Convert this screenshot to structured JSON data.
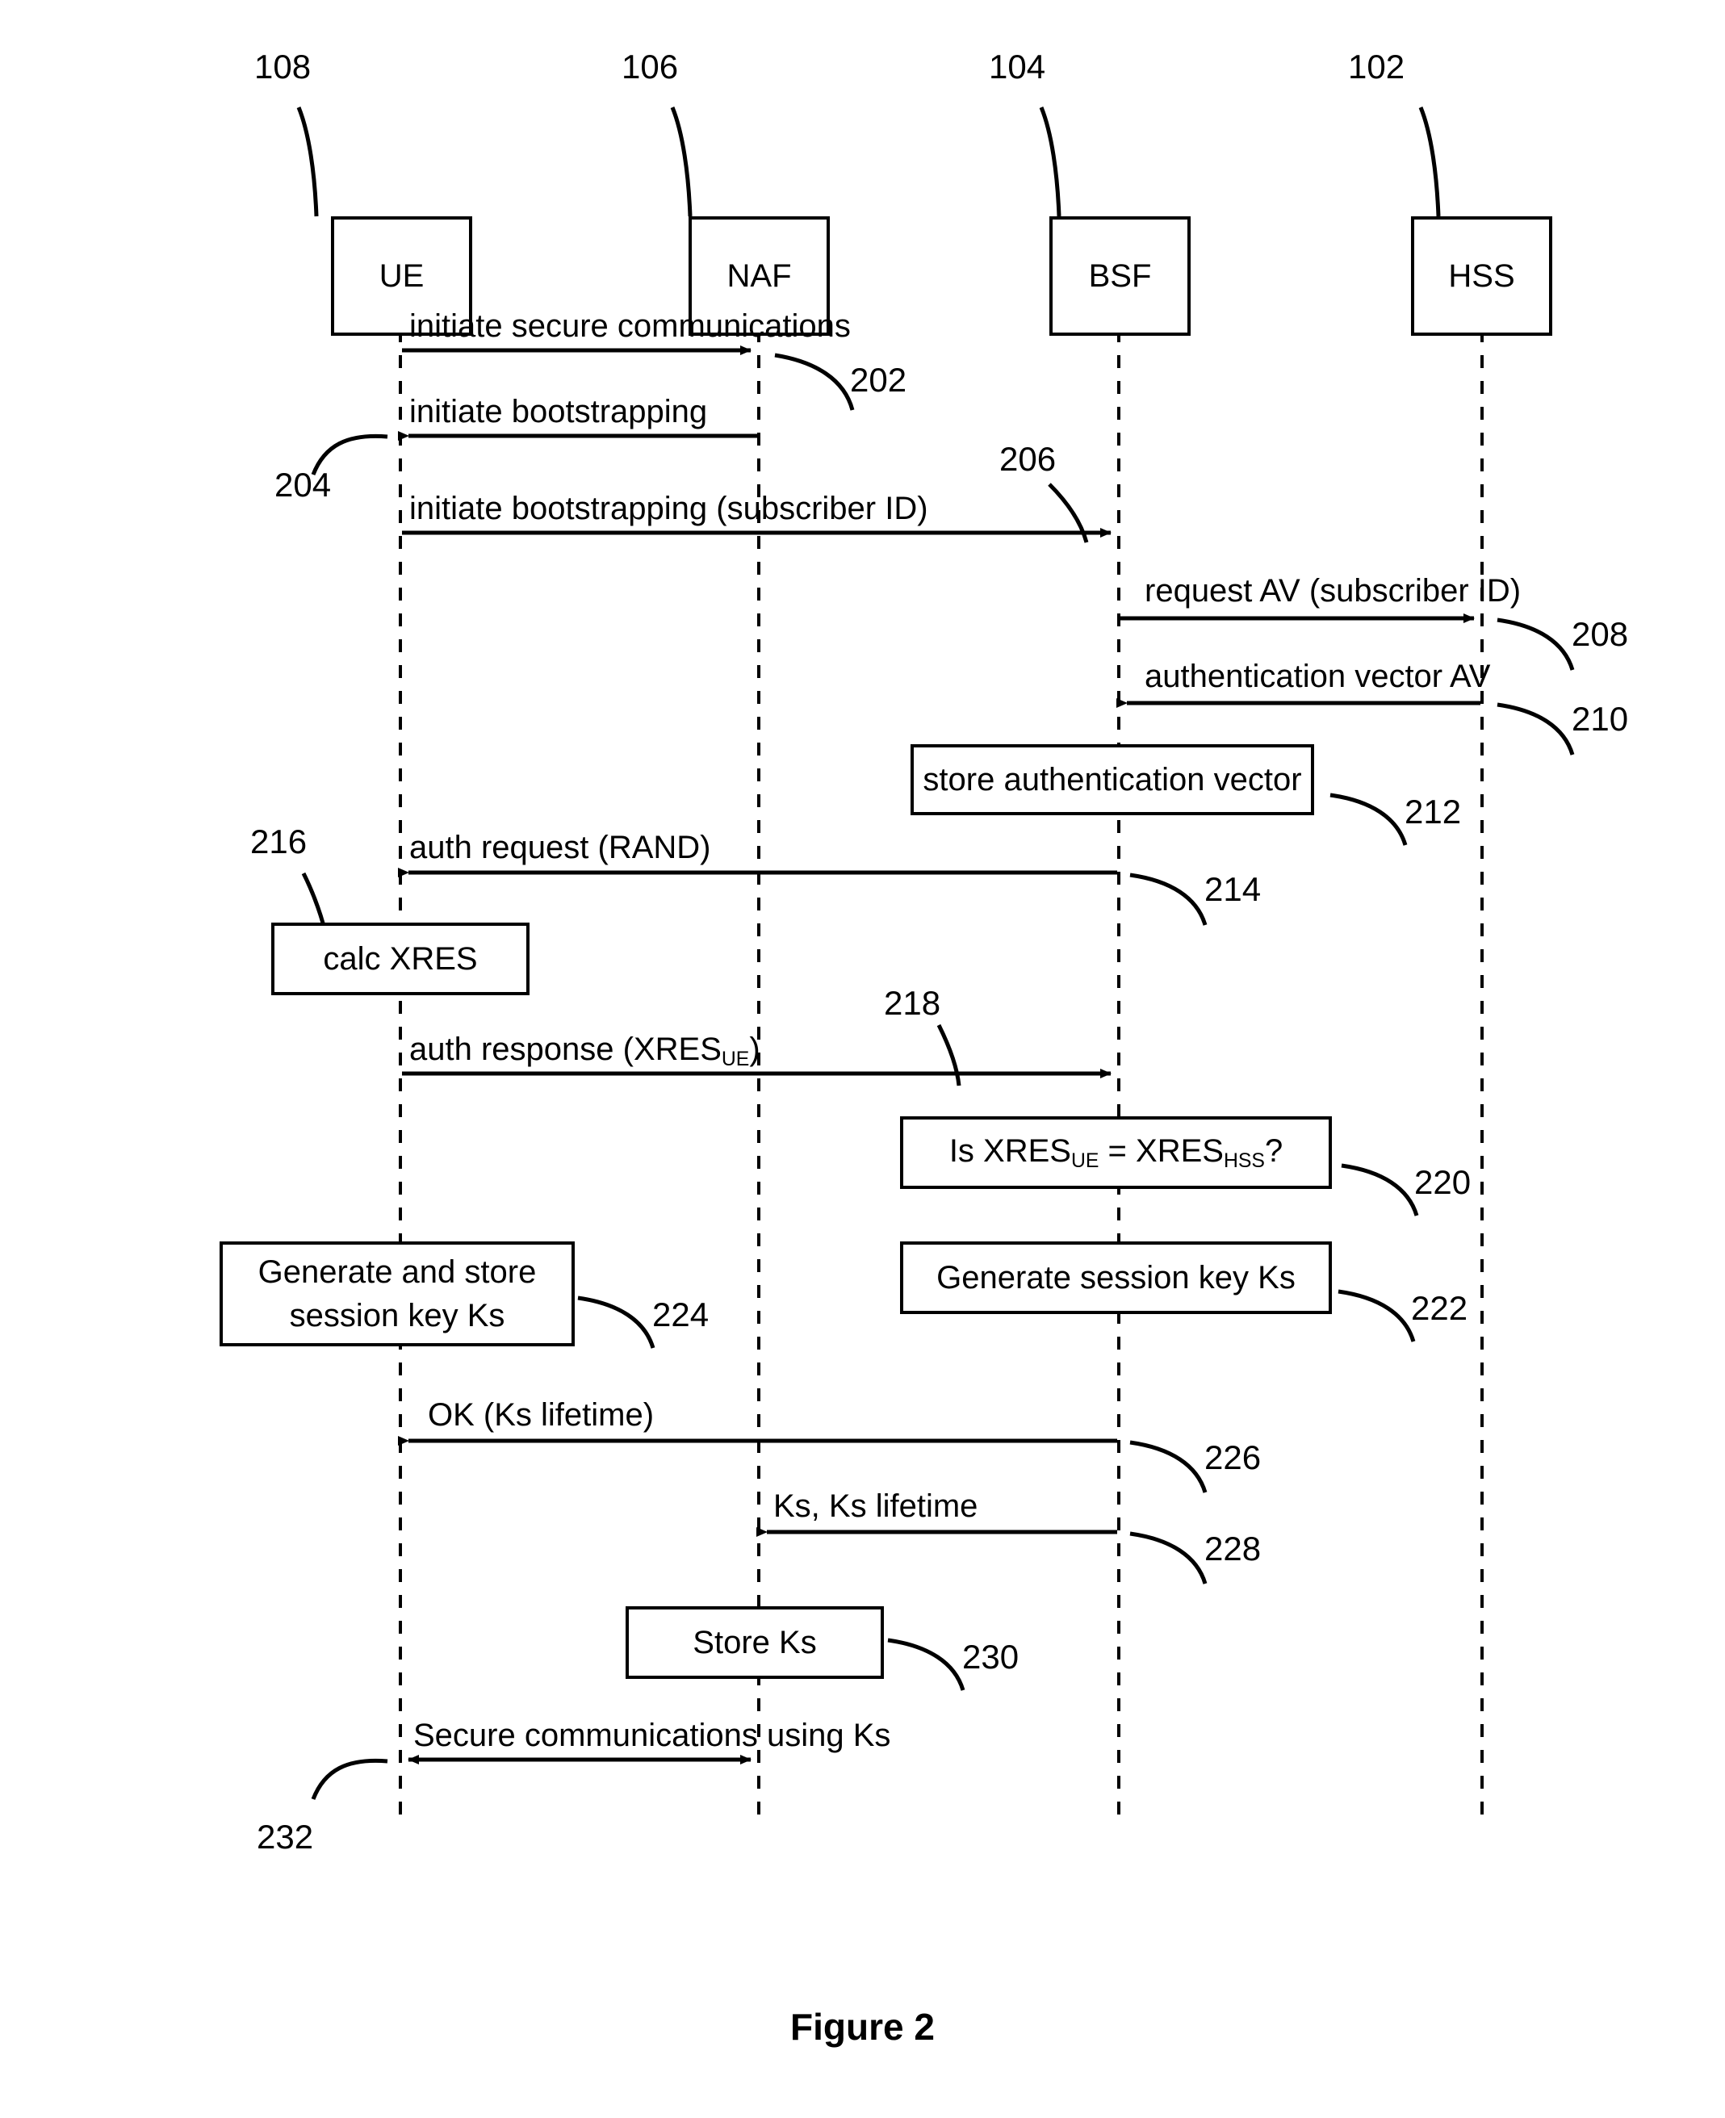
{
  "figure": {
    "caption": "Figure 2",
    "title": "Figure 2"
  },
  "entities": [
    {
      "id": "ue",
      "label": "UE",
      "ref": "108"
    },
    {
      "id": "naf",
      "label": "NAF",
      "ref": "106"
    },
    {
      "id": "bsf",
      "label": "BSF",
      "ref": "104"
    },
    {
      "id": "hss",
      "label": "HSS",
      "ref": "102"
    }
  ],
  "messages": [
    {
      "ref": "202",
      "label": "initiate secure communications",
      "from": "UE",
      "to": "NAF",
      "direction": "right"
    },
    {
      "ref": "204",
      "label": "initiate bootstrapping",
      "from": "NAF",
      "to": "UE",
      "direction": "left"
    },
    {
      "ref": "206",
      "label": "initiate bootstrapping (subscriber ID)",
      "from": "UE",
      "to": "BSF",
      "direction": "right"
    },
    {
      "ref": "208",
      "label": "request AV (subscriber ID)",
      "from": "BSF",
      "to": "HSS",
      "direction": "right"
    },
    {
      "ref": "210",
      "label": "authentication vector AV",
      "from": "HSS",
      "to": "BSF",
      "direction": "left"
    },
    {
      "ref": "214",
      "label": "auth request (RAND)",
      "from": "BSF",
      "to": "UE",
      "direction": "left"
    },
    {
      "ref": "218",
      "label_pre": "auth response (XRES",
      "label_sub": "UE",
      "label_post": ")",
      "from": "UE",
      "to": "BSF",
      "direction": "right"
    },
    {
      "ref": "226",
      "label": "OK (Ks lifetime)",
      "from": "BSF",
      "to": "UE",
      "direction": "left"
    },
    {
      "ref": "228",
      "label": "Ks, Ks lifetime",
      "from": "BSF",
      "to": "NAF",
      "direction": "left"
    },
    {
      "ref": "232",
      "label": "Secure communications using Ks",
      "from": "UE",
      "to": "NAF",
      "direction": "both"
    }
  ],
  "action_boxes": [
    {
      "ref": "212",
      "lifeline": "BSF",
      "label": "store authentication vector"
    },
    {
      "ref": "216",
      "lifeline": "UE",
      "label": "calc XRES"
    },
    {
      "ref": "220",
      "lifeline": "BSF",
      "label_pre": "Is XRES",
      "label_sub1": "UE",
      "label_mid": " = XRES",
      "label_sub2": "HSS",
      "label_post": "?"
    },
    {
      "ref": "222",
      "lifeline": "BSF",
      "label": "Generate session key Ks"
    },
    {
      "ref": "224",
      "lifeline": "UE",
      "label_line1": "Generate and store",
      "label_line2": "session key Ks"
    },
    {
      "ref": "230",
      "lifeline": "NAF",
      "label": "Store Ks"
    }
  ],
  "colors": {
    "line": "#000000",
    "background": "#ffffff"
  }
}
